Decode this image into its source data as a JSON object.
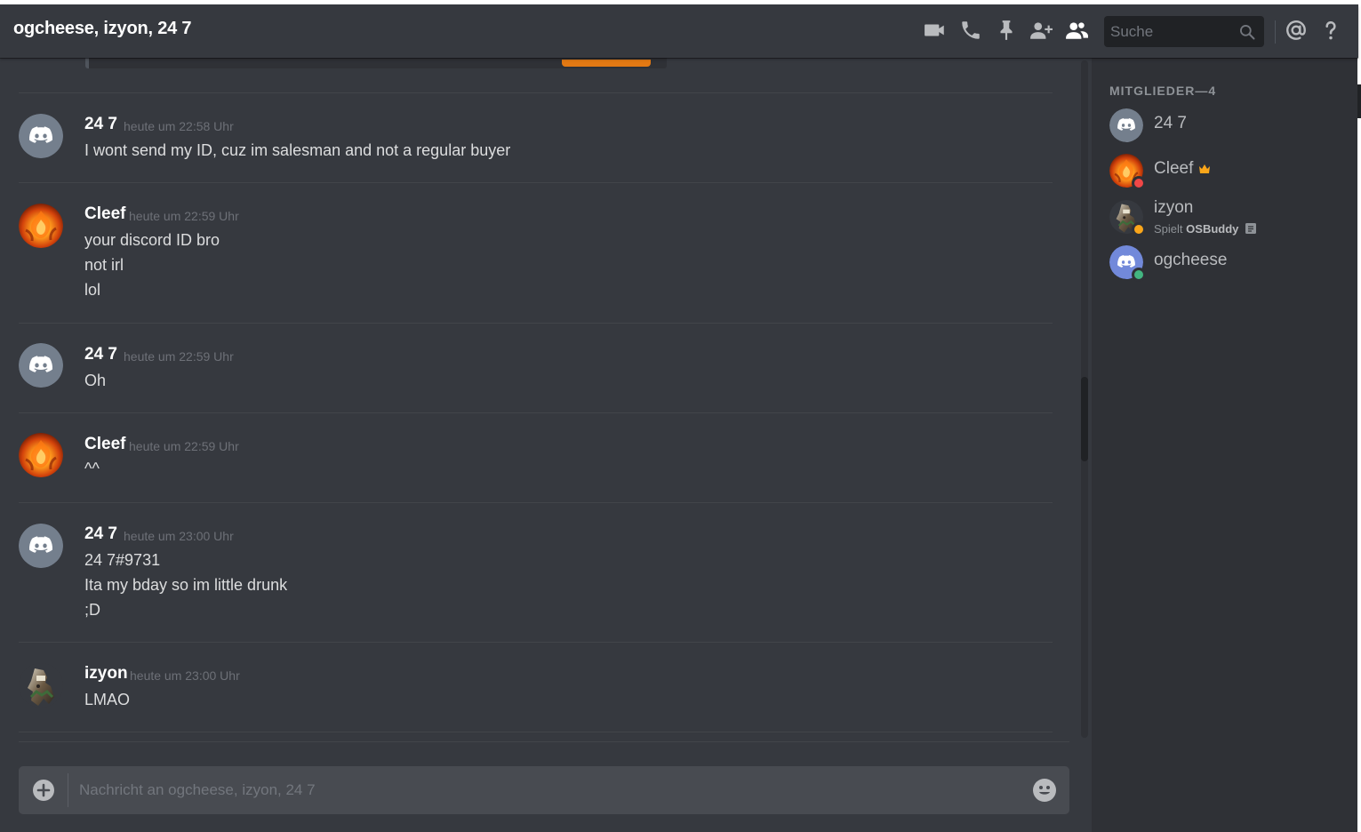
{
  "header": {
    "title": "ogcheese, izyon, 24 7",
    "search_placeholder": "Suche",
    "icons": [
      "video-call-icon",
      "phone-call-icon",
      "pin-icon",
      "add-friend-icon",
      "members-icon",
      "search-icon",
      "mention-icon",
      "help-icon"
    ]
  },
  "messages": [
    {
      "author": "24 7",
      "timestamp": "heute um 22:58 Uhr",
      "avatar": "discord-default-avatar",
      "lines": [
        "I wont send my ID, cuz im salesman and not a regular buyer"
      ]
    },
    {
      "author": "Cleef",
      "timestamp": "heute um 22:59 Uhr",
      "avatar": "fire-avatar",
      "lines": [
        "your discord ID bro",
        "not irl",
        "lol"
      ]
    },
    {
      "author": "24 7",
      "timestamp": "heute um 22:59 Uhr",
      "avatar": "discord-default-avatar",
      "lines": [
        "Oh"
      ]
    },
    {
      "author": "Cleef",
      "timestamp": "heute um 22:59 Uhr",
      "avatar": "fire-avatar",
      "lines": [
        "^^"
      ]
    },
    {
      "author": "24 7",
      "timestamp": "heute um 23:00 Uhr",
      "avatar": "discord-default-avatar",
      "lines": [
        "24 7#9731",
        "Ita my bday so im little drunk",
        ";D"
      ]
    },
    {
      "author": "izyon",
      "timestamp": "heute um 23:00 Uhr",
      "avatar": "character-avatar",
      "lines": [
        "LMAO"
      ]
    }
  ],
  "composer": {
    "placeholder": "Nachricht an ogcheese, izyon, 24 7"
  },
  "members": {
    "heading": "MITGLIEDER—4",
    "list": [
      {
        "name": "24 7",
        "status": "none",
        "avatar": "discord-default-avatar"
      },
      {
        "name": "Cleef",
        "status": "dnd",
        "owner": true,
        "avatar": "fire-avatar"
      },
      {
        "name": "izyon",
        "status": "idle",
        "activity_prefix": "Spielt",
        "activity_name": "OSBuddy",
        "avatar": "character-avatar"
      },
      {
        "name": "ogcheese",
        "status": "online",
        "avatar": "discord-blurple-avatar"
      }
    ]
  },
  "colors": {
    "background": "#36393f",
    "sidebar": "#2f3136",
    "blurple": "#7289da",
    "online": "#43b581",
    "idle": "#faa61a",
    "dnd": "#f04747",
    "owner_crown": "#faa61a"
  }
}
